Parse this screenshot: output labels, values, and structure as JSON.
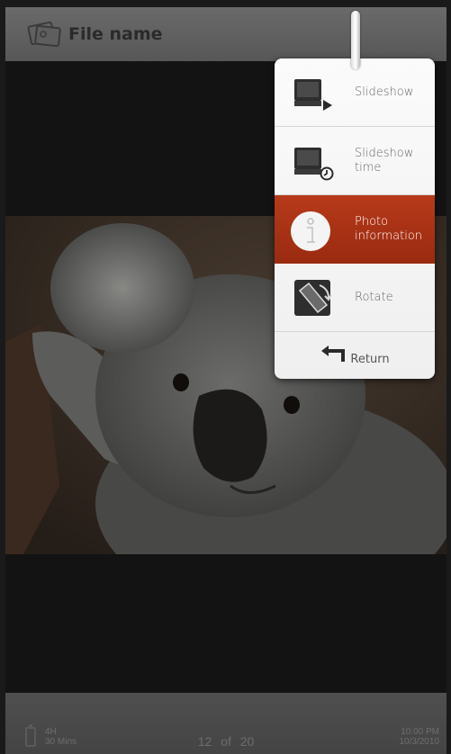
{
  "header": {
    "title": "File name",
    "icon": "photo-album-icon"
  },
  "menu": {
    "items": [
      {
        "label": "Slideshow",
        "icon": "slideshow-icon",
        "active": false
      },
      {
        "label": "Slideshow\ntime",
        "icon": "slideshow-timer-icon",
        "active": false
      },
      {
        "label": "Photo\ninformation",
        "icon": "info-icon",
        "active": true
      },
      {
        "label": "Rotate",
        "icon": "rotate-icon",
        "active": false
      }
    ],
    "return_label": "Return",
    "active_color": "#b2371a"
  },
  "footer": {
    "battery_hours": "4H",
    "battery_mins": "30 Mins",
    "counter_current": "12",
    "counter_of": "of",
    "counter_total": "20",
    "time": "10:00 PM",
    "date": "10/3/2010"
  }
}
